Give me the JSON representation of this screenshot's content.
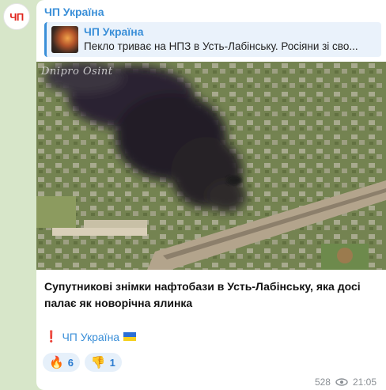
{
  "channel": {
    "avatar_text": "ЧП",
    "name": "ЧП Україна"
  },
  "reply": {
    "sender": "ЧП Україна",
    "text": "Пекло триває на НПЗ в Усть-Лабінську. Росіяни зі сво..."
  },
  "photo": {
    "watermark": "Dnipro Osint"
  },
  "message": {
    "caption": "Супутникові знімки нафтобази в Усть-Лабінську, яка досі палає як новорічна ялинка",
    "signature_mark": "❗",
    "signature_link": "ЧП Україна"
  },
  "reactions": [
    {
      "emoji": "🔥",
      "count": "6"
    },
    {
      "emoji": "👎",
      "count": "1"
    }
  ],
  "meta": {
    "views": "528",
    "time": "21:05"
  },
  "colors": {
    "accent": "#3a8fd8",
    "avatar_red": "#e0231b",
    "background": "#d7e6c9"
  }
}
